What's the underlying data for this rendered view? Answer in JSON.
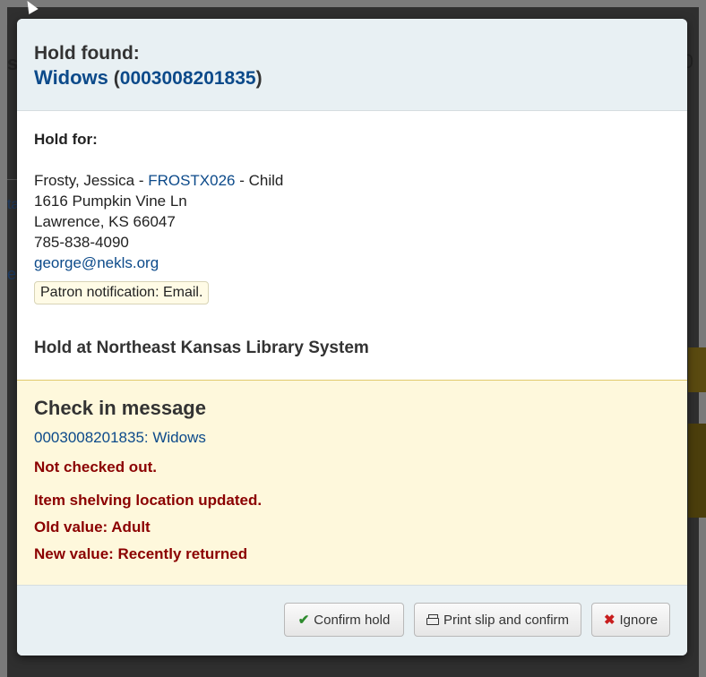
{
  "background": {
    "title_fragment": "s",
    "right_fragment": "0",
    "link_fragment_1": "ta",
    "link_fragment_2": "e"
  },
  "modal": {
    "header": {
      "title": "Hold found:",
      "item_title": "Widows",
      "barcode_open": "(",
      "barcode": "0003008201835",
      "barcode_close": ")"
    },
    "body": {
      "hold_for_label": "Hold for:",
      "patron_name": "Frosty, Jessica - ",
      "patron_card": "FROSTX026",
      "patron_category": " - Child",
      "address_line1": "1616 Pumpkin Vine Ln",
      "address_line2": "Lawrence, KS 66047",
      "phone": "785-838-4090",
      "email": "george@nekls.org",
      "notification": "Patron notification: Email.",
      "hold_at": "Hold at Northeast Kansas Library System"
    },
    "checkin_message": {
      "title": "Check in message",
      "item_link": "0003008201835: Widows",
      "not_checked_out": "Not checked out.",
      "location_updated": "Item shelving location updated.",
      "old_value": "Old value: Adult",
      "new_value": "New value: Recently returned"
    },
    "footer": {
      "confirm_label": "Confirm hold",
      "print_label": "Print slip and confirm",
      "ignore_label": "Ignore"
    }
  },
  "icons": {
    "confirm": "check-icon",
    "print": "print-icon",
    "ignore": "x-icon"
  },
  "colors": {
    "link": "#0c4a8a",
    "alert_red": "#8b0000",
    "message_bg": "#fef8dc",
    "header_bg": "#e8f0f3"
  }
}
